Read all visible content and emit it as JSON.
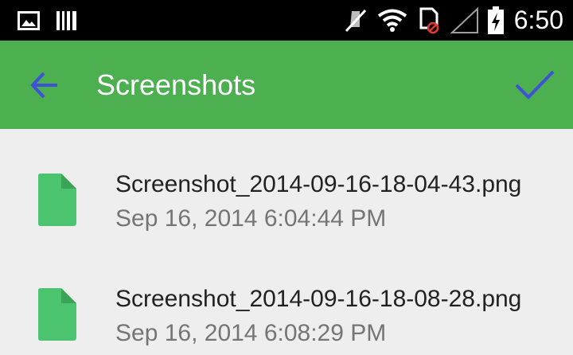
{
  "status_bar": {
    "time": "6:50",
    "icons": [
      "image-icon",
      "barcode-icon",
      "mute-icon",
      "wifi-icon",
      "sim-error-icon",
      "signal-icon",
      "battery-charging-icon"
    ]
  },
  "app_bar": {
    "title": "Screenshots",
    "back_icon": "arrow-back-icon",
    "confirm_icon": "check-icon",
    "background": "#4caf50",
    "icon_color": "#3f51d6"
  },
  "files": [
    {
      "name": "Screenshot_2014-09-16-18-04-43.png",
      "date": "Sep 16, 2014 6:04:44 PM",
      "icon": "file-icon"
    },
    {
      "name": "Screenshot_2014-09-16-18-08-28.png",
      "date": "Sep 16, 2014 6:08:29 PM",
      "icon": "file-icon"
    }
  ],
  "colors": {
    "file_icon": "#4cc36f",
    "status_bar": "#000000",
    "list_background": "#eeeeee"
  }
}
